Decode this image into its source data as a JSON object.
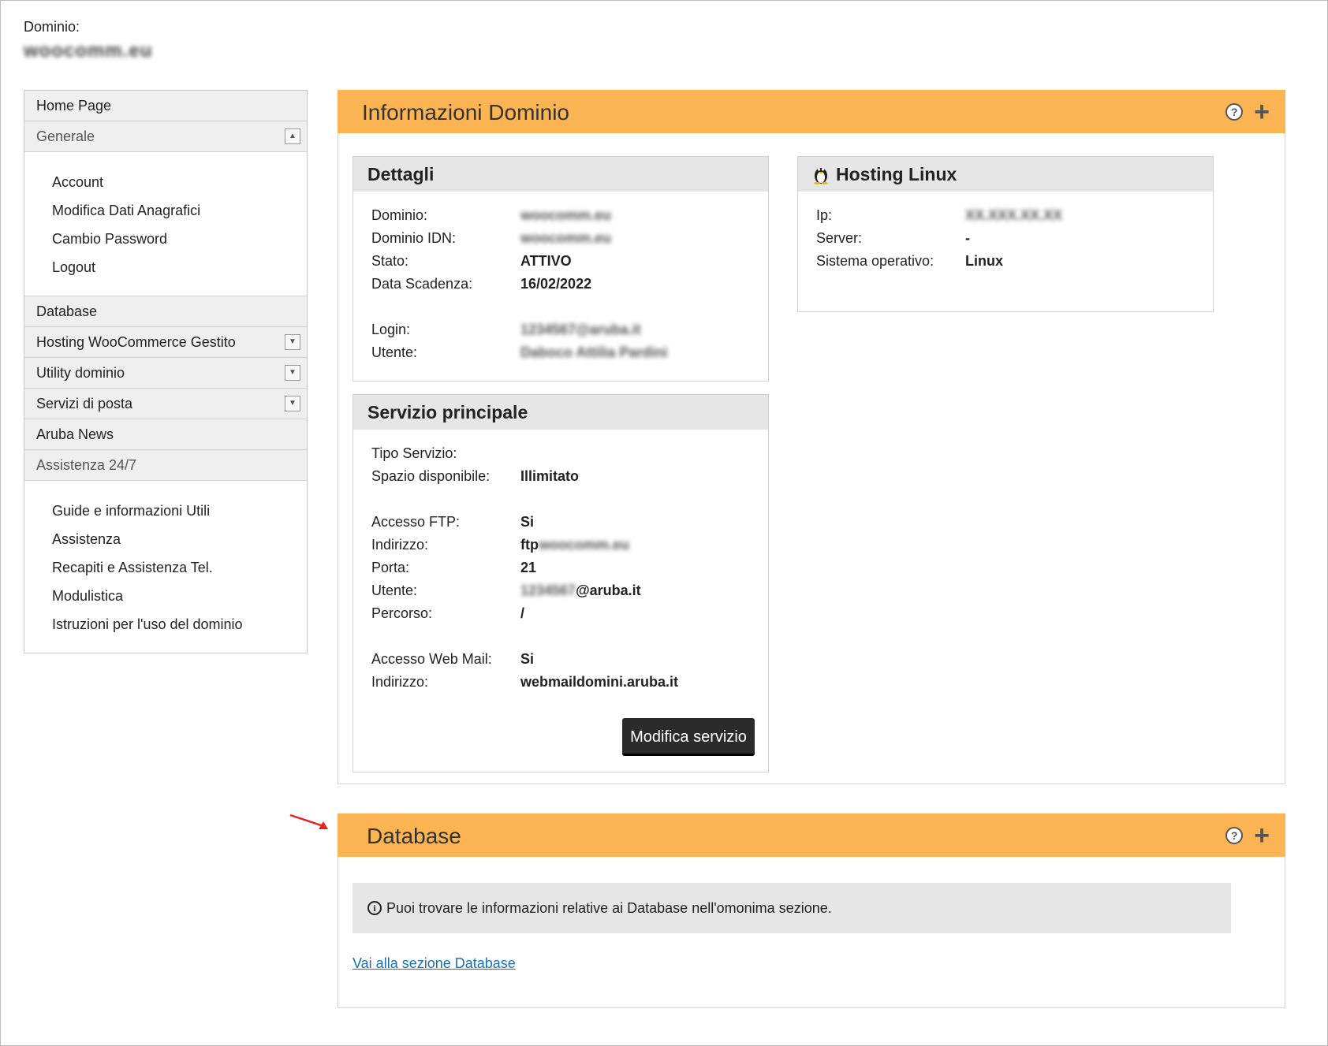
{
  "domain": {
    "label": "Dominio:",
    "name": "woocomm.eu"
  },
  "sidebar": {
    "home": "Home Page",
    "generale": "Generale",
    "generale_items": [
      "Account",
      "Modifica Dati Anagrafici",
      "Cambio Password",
      "Logout"
    ],
    "database": "Database",
    "hosting": "Hosting WooCommerce Gestito",
    "utility": "Utility dominio",
    "posta": "Servizi di posta",
    "news": "Aruba News",
    "assistenza": "Assistenza 24/7",
    "assistenza_items": [
      "Guide e informazioni Utili",
      "Assistenza",
      "Recapiti e Assistenza Tel.",
      "Modulistica",
      "Istruzioni per l'uso del dominio"
    ]
  },
  "info_panel": {
    "title": "Informazioni Dominio",
    "dettagli": {
      "title": "Dettagli",
      "rows": [
        {
          "label": "Dominio:",
          "value": "woocomm.eu"
        },
        {
          "label": "Dominio IDN:",
          "value": "woocomm.eu"
        },
        {
          "label": "Stato:",
          "value": "ATTIVO"
        },
        {
          "label": "Data Scadenza:",
          "value": "16/02/2022"
        },
        {
          "label": "Login:",
          "value": "1234567@aruba.it"
        },
        {
          "label": "Utente:",
          "value": "Daboco Attilia Pardini"
        }
      ]
    },
    "hosting": {
      "title": "Hosting Linux",
      "rows": [
        {
          "label": "Ip:",
          "value": "XX.XXX.XX.XX"
        },
        {
          "label": "Server:",
          "value": "-"
        },
        {
          "label": "Sistema operativo:",
          "value": "Linux"
        }
      ]
    },
    "servizio": {
      "title": "Servizio principale",
      "rows": [
        {
          "label": "Tipo Servizio:",
          "value": ""
        },
        {
          "label": "Spazio disponibile:",
          "value": "Illimitato"
        },
        {
          "label": "Accesso FTP:",
          "value": "Si"
        },
        {
          "label": "Indirizzo:",
          "value": "ftp",
          "blur": "woocomm.eu"
        },
        {
          "label": "Porta:",
          "value": "21"
        },
        {
          "label": "Utente:",
          "blur_pre": "1234567",
          "value": "@aruba.it"
        },
        {
          "label": "Percorso:",
          "value": "/"
        },
        {
          "label": "Accesso Web Mail:",
          "value": "Si"
        },
        {
          "label": "Indirizzo:",
          "value": "webmaildomini.aruba.it"
        }
      ],
      "button": "Modifica servizio"
    }
  },
  "db_panel": {
    "title": "Database",
    "info": "Puoi trovare le informazioni relative ai Database nell'omonima sezione.",
    "link": "Vai alla sezione Database"
  },
  "colors": {
    "panel_header": "#fdb453",
    "button": "#2b2b2b",
    "link": "#1a6fb5",
    "arrow": "#e8201e"
  }
}
